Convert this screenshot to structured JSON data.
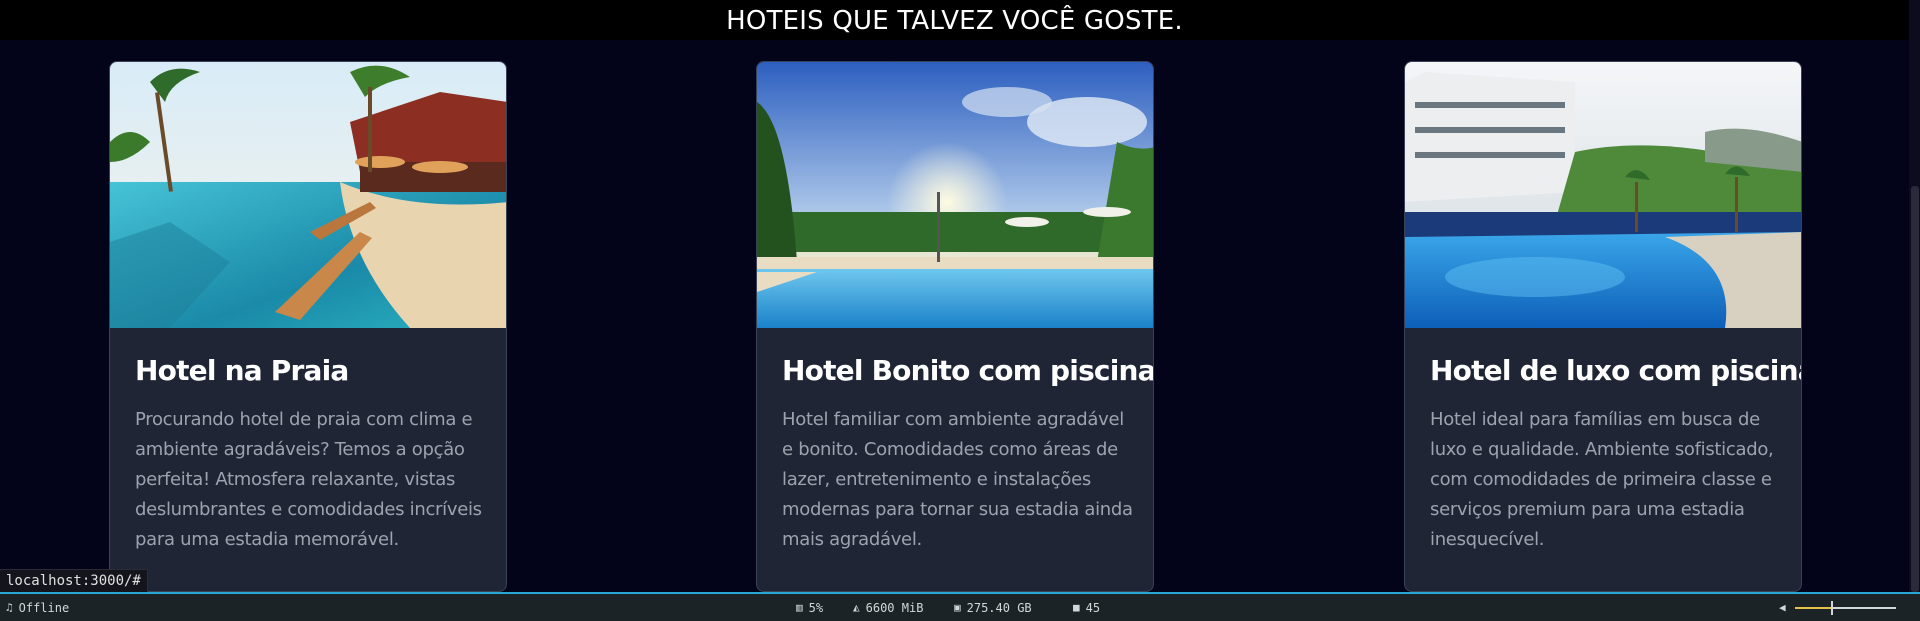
{
  "banner": {
    "title": "HOTEIS QUE TALVEZ VOCÊ GOSTE."
  },
  "hotels": [
    {
      "title": "Hotel na Praia",
      "description": "Procurando hotel de praia com clima e ambiente agradáveis? Temos a opção perfeita! Atmosfera relaxante, vistas deslumbrantes e comodidades incríveis para uma estadia memorável.",
      "image_icon": "beach-resort-photo"
    },
    {
      "title": "Hotel Bonito com piscina",
      "description": "Hotel familiar com ambiente agradável e bonito. Comodidades como áreas de lazer, entretenimento e instalações modernas para tornar sua estadia ainda mais agradável.",
      "image_icon": "pool-sunset-photo"
    },
    {
      "title": "Hotel de luxo com piscina",
      "description": "Hotel ideal para famílias em busca de luxo e qualidade. Ambiente sofisticado, com comodidades de primeira classe e serviços premium para uma estadia inesquecível.",
      "image_icon": "luxury-pool-photo"
    }
  ],
  "browser": {
    "status_url": "localhost:3000/#"
  },
  "statusbar": {
    "music_icon": "music-note-icon",
    "music_status": "Offline",
    "cpu_icon": "bar-chart-icon",
    "cpu": "5%",
    "memory_icon": "area-chart-icon",
    "memory": "6600 MiB",
    "disk_icon": "drive-icon",
    "disk": "275.40 GB",
    "updates_icon": "package-icon",
    "updates": "45",
    "volume_icon": "speaker-icon",
    "volume_level": 0.36,
    "accent_color": "#2aa6d6",
    "volume_color": "#e6c14a"
  }
}
